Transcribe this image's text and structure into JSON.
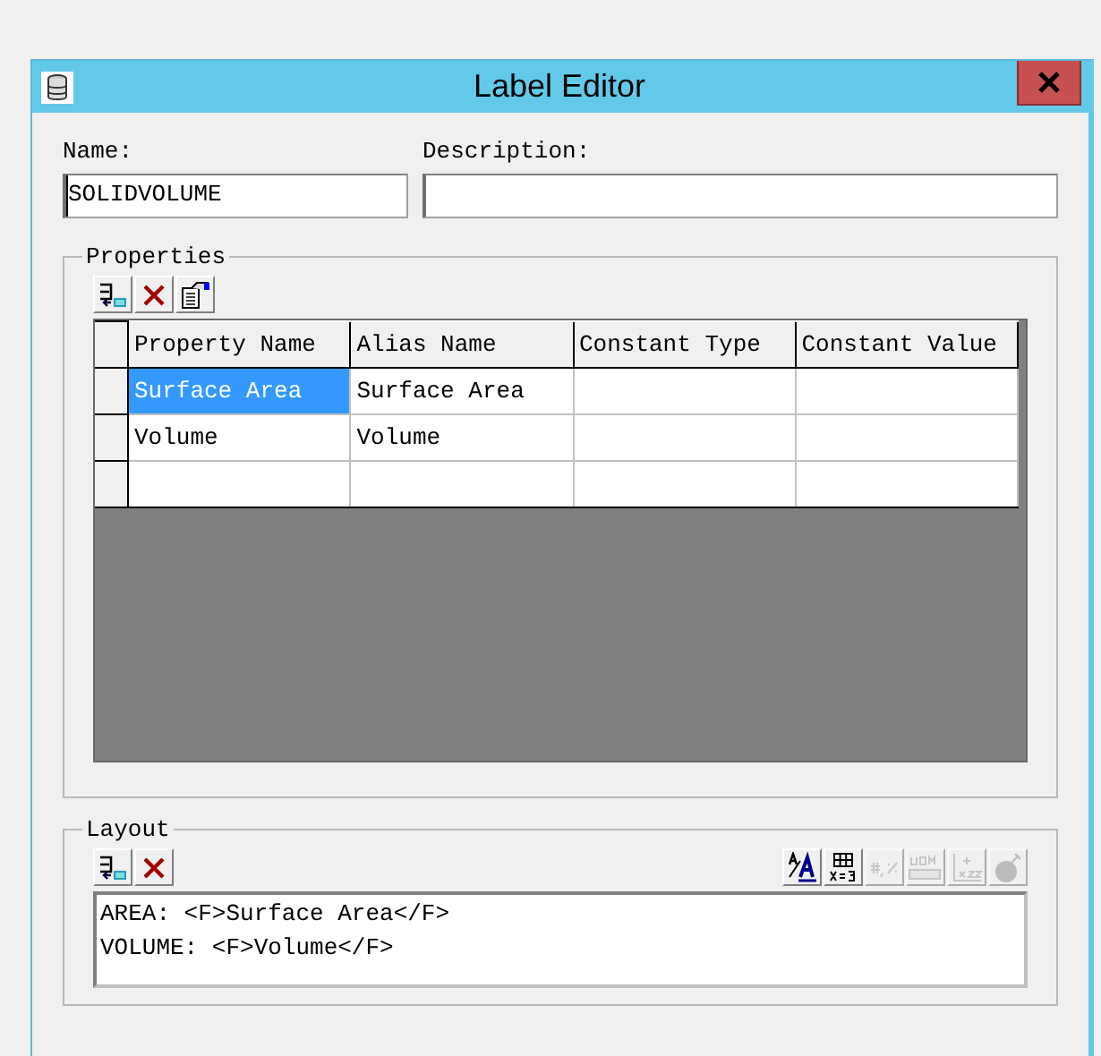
{
  "window": {
    "title": "Label Editor"
  },
  "name_field": {
    "label": "Name:",
    "value": "SOLIDVOLUME",
    "focused": true
  },
  "description_field": {
    "label": "Description:"
  },
  "properties": {
    "title": "Properties",
    "toolbar": [
      {
        "kind": "add",
        "disabled": false
      },
      {
        "kind": "delete",
        "disabled": false
      },
      {
        "kind": "properties",
        "disabled": false
      }
    ],
    "table": {
      "columns": [
        "Property Name",
        "Alias Name",
        "Constant Type",
        "Constant Value"
      ],
      "rows": [
        {
          "cells": [
            {
              "text": "Surface Area",
              "selected": true
            },
            {
              "text": "Surface Area",
              "selected": false
            },
            {
              "selected": false
            },
            {
              "selected": false
            }
          ]
        },
        {
          "cells": [
            {
              "text": "Volume",
              "selected": false
            },
            {
              "text": "Volume",
              "selected": false
            },
            {
              "selected": false
            },
            {
              "selected": false
            }
          ]
        },
        {
          "cells": [
            {
              "selected": false
            },
            {
              "selected": false
            },
            {
              "selected": false
            },
            {
              "selected": false
            }
          ]
        }
      ]
    }
  },
  "layout": {
    "title": "Layout",
    "toolbar": [
      {
        "kind": "add",
        "disabled": false
      },
      {
        "kind": "delete",
        "disabled": false
      }
    ],
    "format_toolbar": [
      {
        "kind": "font",
        "disabled": false
      },
      {
        "kind": "table",
        "disabled": false
      },
      {
        "kind": "number-format",
        "disabled": true
      },
      {
        "kind": "units",
        "disabled": true
      },
      {
        "kind": "coordinates",
        "disabled": true
      },
      {
        "kind": "bomb",
        "disabled": true
      }
    ],
    "lines": [
      "AREA: <F>Surface Area</F>",
      "VOLUME: <F>Volume</F>"
    ]
  }
}
